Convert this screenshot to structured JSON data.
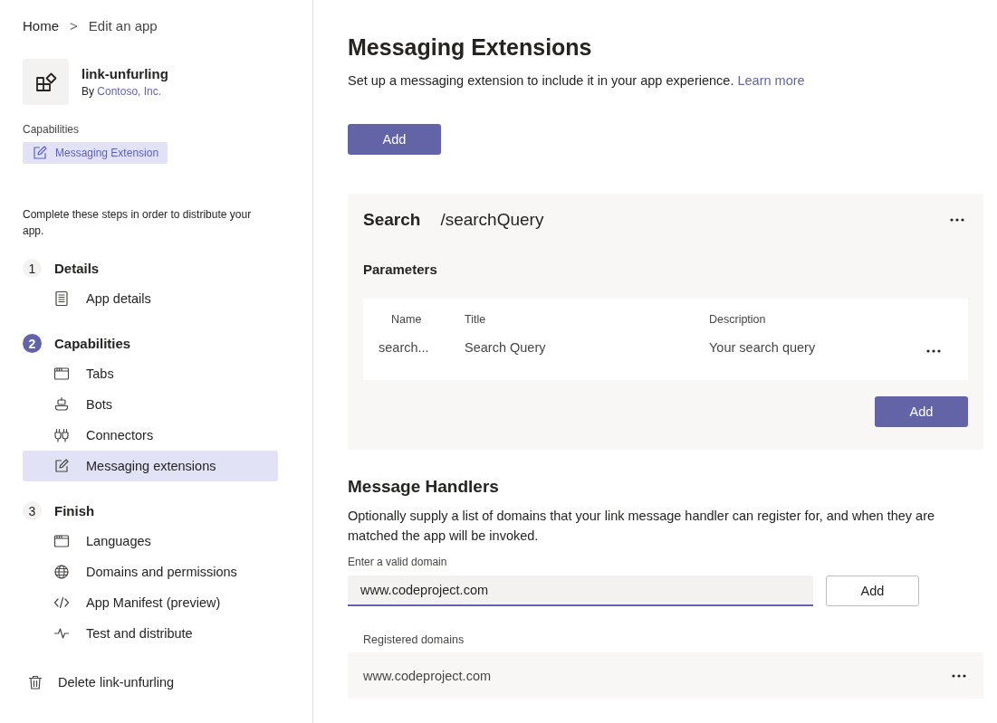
{
  "breadcrumb": {
    "home": "Home",
    "separator": ">",
    "current": "Edit an app"
  },
  "app": {
    "name": "link-unfurling",
    "by": "By",
    "publisher": "Contoso, Inc."
  },
  "capabilities": {
    "label": "Capabilities",
    "chips": [
      "Messaging Extension"
    ]
  },
  "instructions": "Complete these steps in order to distribute your app.",
  "steps": [
    {
      "number": "1",
      "title": "Details",
      "current": false,
      "items": [
        {
          "kind": "document",
          "label": "App details",
          "selected": false
        }
      ]
    },
    {
      "number": "2",
      "title": "Capabilities",
      "current": true,
      "items": [
        {
          "kind": "tab",
          "label": "Tabs",
          "selected": false
        },
        {
          "kind": "bot",
          "label": "Bots",
          "selected": false
        },
        {
          "kind": "connector",
          "label": "Connectors",
          "selected": false
        },
        {
          "kind": "edit",
          "label": "Messaging extensions",
          "selected": true
        }
      ]
    },
    {
      "number": "3",
      "title": "Finish",
      "current": false,
      "items": [
        {
          "kind": "tab",
          "label": "Languages",
          "selected": false
        },
        {
          "kind": "globe",
          "label": "Domains and permissions",
          "selected": false
        },
        {
          "kind": "code",
          "label": "App Manifest (preview)",
          "selected": false
        },
        {
          "kind": "pulse",
          "label": "Test and distribute",
          "selected": false
        }
      ]
    }
  ],
  "delete_label": "Delete link-unfurling",
  "main": {
    "title": "Messaging Extensions",
    "subtitle": "Set up a messaging extension to include it in your app experience.",
    "learn_more": "Learn more",
    "add_button": "Add",
    "command": {
      "type": "Search",
      "id": "/searchQuery",
      "parameters_label": "Parameters",
      "columns": [
        "Name",
        "Title",
        "Description"
      ],
      "rows": [
        [
          "search...",
          "Search Query",
          "Your search query"
        ]
      ],
      "add_button": "Add"
    },
    "handlers": {
      "title": "Message Handlers",
      "description": "Optionally supply a list of domains that your link message handler can register for, and when they are matched the app will be invoked.",
      "field_label": "Enter a valid domain",
      "field_value": "www.codeproject.com",
      "add_button": "Add",
      "registered_label": "Registered domains",
      "domains": [
        "www.codeproject.com"
      ]
    }
  }
}
